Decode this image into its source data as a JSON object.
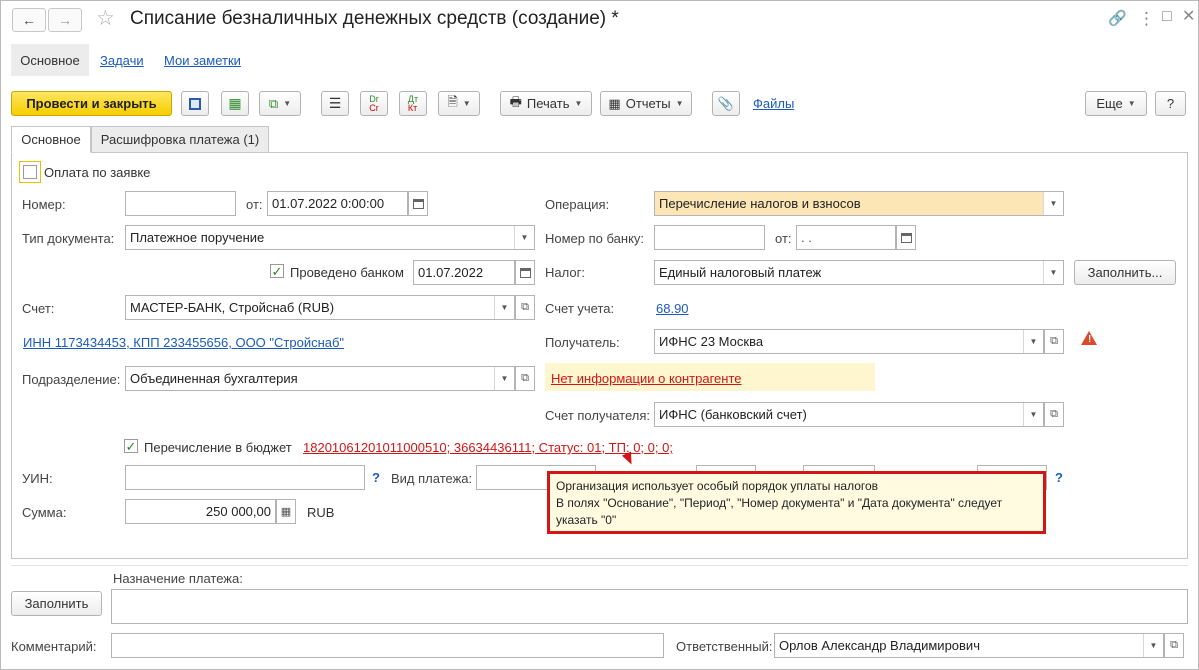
{
  "window": {
    "title": "Списание безналичных денежных средств (создание) *"
  },
  "nav_tabs": {
    "main": "Основное",
    "tasks": "Задачи",
    "notes": "Мои заметки"
  },
  "toolbar": {
    "post_close": "Провести и закрыть",
    "print": "Печать",
    "reports": "Отчеты",
    "files": "Файлы",
    "more": "Еще",
    "help": "?"
  },
  "tabs": {
    "main": "Основное",
    "decode": "Расшифровка платежа (1)"
  },
  "form": {
    "pay_by_request": "Оплата по заявке",
    "number_label": "Номер:",
    "number_value": "",
    "from_label": "от:",
    "date_value": "01.07.2022  0:00:00",
    "doctype_label": "Тип документа:",
    "doctype_value": "Платежное поручение",
    "bank_posted_label": "Проведено банком",
    "bank_posted_date": "01.07.2022",
    "account_label": "Счет:",
    "account_value": "МАСТЕР-БАНК, Стройснаб (RUB)",
    "inn_link": "ИНН 1173434453, КПП 233455656, ООО \"Стройснаб\"",
    "division_label": "Подразделение:",
    "division_value": "Объединенная бухгалтерия",
    "operation_label": "Операция:",
    "operation_value": "Перечисление налогов и взносов",
    "bank_number_label": "Номер по банку:",
    "bank_number_value": "",
    "bank_from_label": "от:",
    "bank_from_value": " .  .",
    "tax_label": "Налог:",
    "tax_value": "Единый налоговый платеж",
    "fill_button": "Заполнить...",
    "account_acc_label": "Счет учета:",
    "account_acc_value": "68.90",
    "recipient_label": "Получатель:",
    "recipient_value": "ИФНС 23 Москва",
    "no_contractor_info": "Нет информации о контрагенте",
    "recipient_account_label": "Счет получателя:",
    "recipient_account_value": "ИФНС (банковский счет)",
    "budget_transfer_label": "Перечисление в бюджет",
    "budget_details": "18201061201011000510; 36634436111; Статус: 01; ТП: 0; 0; 0;",
    "uin_label": "УИН:",
    "uin_value": "",
    "payment_type_label": "Вид платежа:",
    "sum_label": "Сумма:",
    "sum_value": "250 000,00",
    "currency": "RUB"
  },
  "tooltip": {
    "line1": "Организация использует особый порядок уплаты налогов",
    "line2": "В полях \"Основание\", \"Период\", \"Номер документа\" и \"Дата документа\" следует",
    "line3": "указать \"0\""
  },
  "footer": {
    "purpose_label": "Назначение платежа:",
    "fill_button": "Заполнить",
    "purpose_value": "",
    "comment_label": "Комментарий:",
    "comment_value": "",
    "responsible_label": "Ответственный:",
    "responsible_value": "Орлов Александр Владимирович"
  },
  "colors": {
    "accent_yellow": "#f5cd00",
    "highlight_field": "#fde6b6",
    "warning_bg": "#fdf6cf",
    "link_blue": "#1a5bbd",
    "error_red": "#d41515"
  }
}
